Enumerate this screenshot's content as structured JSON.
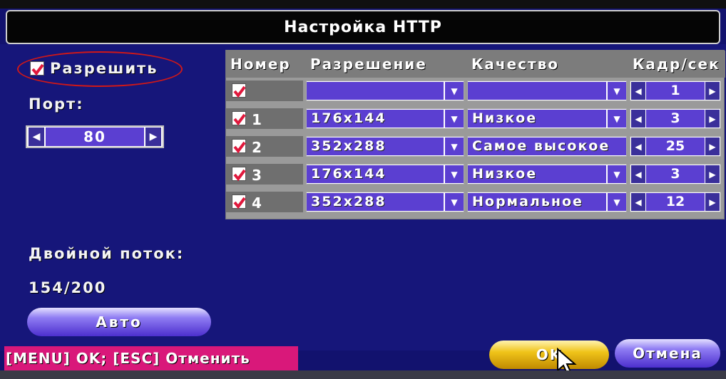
{
  "title": "Настройка HTTP",
  "enable": {
    "label": "Разрешить",
    "checked": true
  },
  "port": {
    "label": "Порт:",
    "value": "80"
  },
  "table": {
    "headers": [
      "Номер",
      "Разрешение",
      "Качество",
      "Кадр/сек"
    ],
    "rows": [
      {
        "number": "",
        "resolution": "",
        "quality": "",
        "fps": "1",
        "checked": true
      },
      {
        "number": "1",
        "resolution": "176x144",
        "quality": "Низкое",
        "fps": "3",
        "checked": true
      },
      {
        "number": "2",
        "resolution": "352x288",
        "quality": "Самое высокое",
        "fps": "25",
        "checked": true
      },
      {
        "number": "3",
        "resolution": "176x144",
        "quality": "Низкое",
        "fps": "3",
        "checked": true
      },
      {
        "number": "4",
        "resolution": "352x288",
        "quality": "Нормальное",
        "fps": "12",
        "checked": true
      }
    ]
  },
  "dual_stream": {
    "label": "Двойной поток:",
    "value": "154/200"
  },
  "auto_button": "Авто",
  "hint": "[MENU] OK; [ESC] Отменить",
  "ok_button": "OK",
  "cancel_button": "Отмена",
  "colors": {
    "panel": "#16167a",
    "field": "#5b3fd1",
    "checkmark": "#e0183c",
    "hint_bg": "#d9187a",
    "ok": "#f0c41a"
  },
  "icons": [
    "checkbox-checked-icon",
    "left-arrow-icon",
    "right-arrow-icon",
    "dropdown-arrow-icon",
    "mouse-cursor-icon"
  ]
}
